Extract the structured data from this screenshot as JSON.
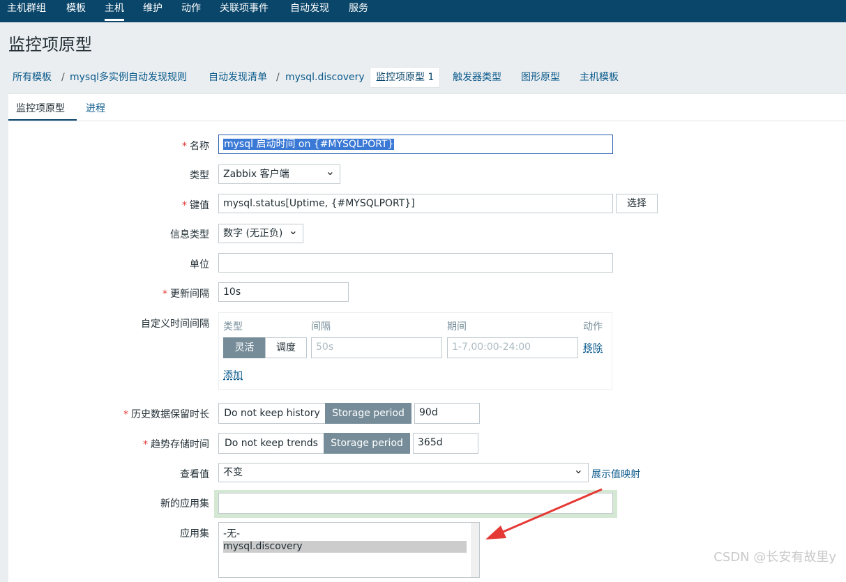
{
  "topnav": [
    "主机群组",
    "模板",
    "主机",
    "维护",
    "动作",
    "关联项事件",
    "自动发现",
    "服务"
  ],
  "page_title": "监控项原型",
  "breadcrumb": {
    "all_templates": "所有模板",
    "template": "mysql多实例自动发现规则",
    "discovery_list": "自动发现清单",
    "discovery": "mysql.discovery",
    "current": "监控项原型 1",
    "trigger_types": "触发器类型",
    "graph_prototypes": "图形原型",
    "host_templates": "主机模板",
    "separator": "/"
  },
  "tabs": [
    "监控项原型",
    "进程"
  ],
  "required_mark": "*",
  "form": {
    "name_label": "名称",
    "name_value": "mysql 启动时间 on {#MYSQLPORT}",
    "type_label": "类型",
    "type_value": "Zabbix 客户端",
    "key_label": "键值",
    "key_value": "mysql.status[Uptime, {#MYSQLPORT}]",
    "key_select_btn": "选择",
    "info_type_label": "信息类型",
    "info_type_value": "数字 (无正负)",
    "unit_label": "单位",
    "unit_value": "",
    "interval_label": "更新间隔",
    "interval_value": "10s",
    "custom_label": "自定义时间间隔",
    "custom_headers": [
      "类型",
      "间隔",
      "期间",
      "动作"
    ],
    "custom_flex": "灵活",
    "custom_schedule": "调度",
    "custom_interval_ph": "50s",
    "custom_period_ph": "1-7,00:00-24:00",
    "custom_remove": "移除",
    "custom_add": "添加",
    "history_label": "历史数据保留时长",
    "history_off": "Do not keep history",
    "history_on": "Storage period",
    "history_value": "90d",
    "trends_label": "趋势存储时间",
    "trends_off": "Do not keep trends",
    "trends_on": "Storage period",
    "trends_value": "365d",
    "valuemap_label": "查看值",
    "valuemap_value": "不变",
    "valuemap_link": "展示值映射",
    "new_app_label": "新的应用集",
    "new_app_value": "",
    "apps_label": "应用集",
    "apps_options": [
      "-无-",
      "mysql.discovery"
    ]
  },
  "watermark": "CSDN @长安有故里y",
  "colors": {
    "header": "#0a466a",
    "link": "#0a5a8c",
    "segment_active": "#768d99",
    "arrow": "#e53935"
  }
}
